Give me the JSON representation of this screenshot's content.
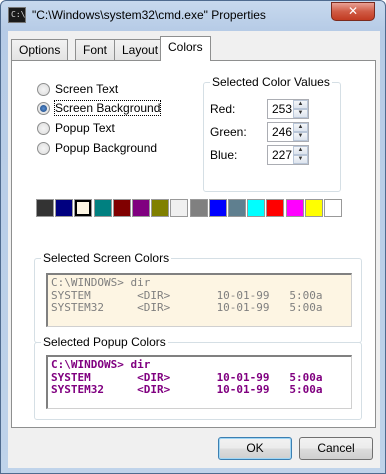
{
  "window": {
    "title": "\"C:\\Windows\\system32\\cmd.exe\" Properties",
    "app_icon_text": "C:\\",
    "close_glyph": "✕"
  },
  "tabs": [
    {
      "label": "Options"
    },
    {
      "label": "Font"
    },
    {
      "label": "Layout"
    },
    {
      "label": "Colors",
      "active": true
    }
  ],
  "radios": [
    {
      "label": "Screen Text",
      "checked": false
    },
    {
      "label": "Screen Background",
      "checked": true
    },
    {
      "label": "Popup Text",
      "checked": false
    },
    {
      "label": "Popup Background",
      "checked": false
    }
  ],
  "color_values": {
    "title": "Selected Color Values",
    "red_label": "Red:",
    "red": "253",
    "green_label": "Green:",
    "green": "246",
    "blue_label": "Blue:",
    "blue": "227"
  },
  "palette": [
    "#333333",
    "#000080",
    "#fdf6e3",
    "#008080",
    "#800000",
    "#800080",
    "#808000",
    "#f0f0f0",
    "#808080",
    "#0000ff",
    "#5f7f8f",
    "#00ffff",
    "#ff0000",
    "#ff00ff",
    "#ffff00",
    "#ffffff"
  ],
  "palette_selected_index": 2,
  "screen_colors": {
    "title": "Selected Screen Colors",
    "lines": [
      "C:\\WINDOWS> dir",
      "SYSTEM       <DIR>       10-01-99   5:00a",
      "SYSTEM32     <DIR>       10-01-99   5:00a"
    ],
    "text_color": "#7f7f7f",
    "background": "#fdf5e3"
  },
  "popup_colors": {
    "title": "Selected Popup Colors",
    "lines": [
      "C:\\WINDOWS> dir",
      "SYSTEM       <DIR>       10-01-99   5:00a",
      "SYSTEM32     <DIR>       10-01-99   5:00a"
    ],
    "text_color": "#800080",
    "background": "#ffffff"
  },
  "buttons": {
    "ok": "OK",
    "cancel": "Cancel"
  }
}
